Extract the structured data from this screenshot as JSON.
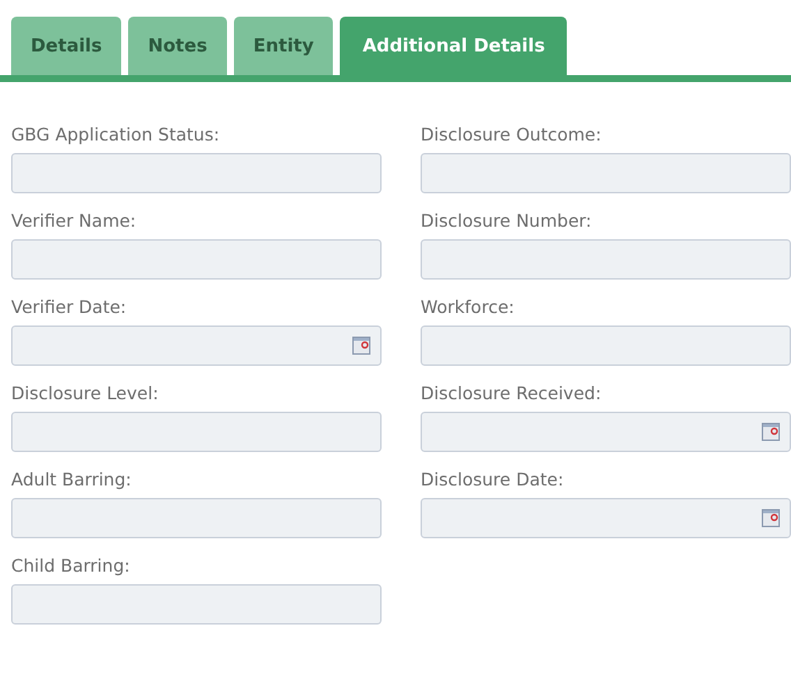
{
  "tabs": [
    {
      "label": "Details",
      "selected": false
    },
    {
      "label": "Notes",
      "selected": false
    },
    {
      "label": "Entity",
      "selected": false
    },
    {
      "label": "Additional Details",
      "selected": true
    }
  ],
  "fields": [
    {
      "label": "GBG Application Status:",
      "kind": "text"
    },
    {
      "label": "Disclosure Outcome:",
      "kind": "text"
    },
    {
      "label": "Verifier Name:",
      "kind": "text"
    },
    {
      "label": "Disclosure Number:",
      "kind": "text"
    },
    {
      "label": "Verifier Date:",
      "kind": "date"
    },
    {
      "label": "Workforce:",
      "kind": "text"
    },
    {
      "label": "Disclosure Level:",
      "kind": "text"
    },
    {
      "label": "Disclosure Received:",
      "kind": "date"
    },
    {
      "label": "Adult Barring:",
      "kind": "text"
    },
    {
      "label": "Disclosure Date:",
      "kind": "date"
    },
    {
      "label": "Child Barring:",
      "kind": "text"
    }
  ]
}
